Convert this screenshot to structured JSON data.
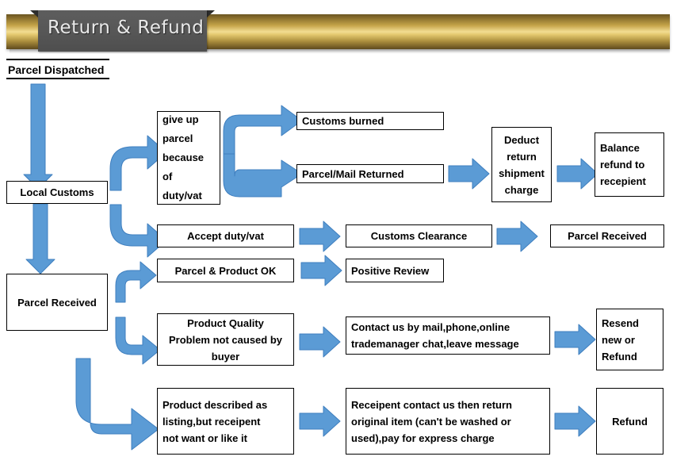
{
  "header": {
    "title": "Return & Refund",
    "bar_color_top": "#6b5522",
    "bar_color_mid": "#f2dd92",
    "ribbon_color": "#585858",
    "title_color": "#e9e9e9"
  },
  "theme": {
    "arrow_fill": "#5b9bd5",
    "arrow_stroke": "#3f7fbf",
    "box_border": "#000000",
    "box_fill": "#ffffff",
    "text_color": "#000000"
  },
  "flowchart": {
    "type": "flowchart",
    "orientation": "left-to-right",
    "nodes": [
      {
        "id": "parcel_dispatched",
        "label": "Parcel Dispatched",
        "style": "banner"
      },
      {
        "id": "local_customs",
        "label": "Local Customs",
        "style": "box-center"
      },
      {
        "id": "parcel_received_l",
        "label": "Parcel Received",
        "style": "box-center"
      },
      {
        "id": "give_up_parcel",
        "label": "give up parcel because of duty/vat",
        "style": "box-left"
      },
      {
        "id": "customs_burned",
        "label": "Customs burned",
        "style": "box-left"
      },
      {
        "id": "parcel_mail_returned",
        "label": "Parcel/Mail Returned",
        "style": "box-left"
      },
      {
        "id": "deduct_charge",
        "label": "Deduct return shipment charge",
        "style": "box-center"
      },
      {
        "id": "balance_refund",
        "label": "Balance refund to recepient",
        "style": "box-left"
      },
      {
        "id": "accept_duty",
        "label": "Accept duty/vat",
        "style": "box-center"
      },
      {
        "id": "customs_clearance",
        "label": "Customs Clearance",
        "style": "box-center"
      },
      {
        "id": "parcel_received_r",
        "label": "Parcel Received",
        "style": "box-center"
      },
      {
        "id": "parcel_product_ok",
        "label": "Parcel & Product OK",
        "style": "box-center"
      },
      {
        "id": "positive_review",
        "label": "Positive Review",
        "style": "box-left"
      },
      {
        "id": "quality_problem",
        "label": "Product Quality Problem not caused by buyer",
        "style": "box-center"
      },
      {
        "id": "contact_us",
        "label": "Contact us by mail,phone,online trademanager chat,leave message",
        "style": "box-left"
      },
      {
        "id": "resend_refund",
        "label": "Resend new or Refund",
        "style": "box-left"
      },
      {
        "id": "described_as_listing",
        "label": "Product described as listing,but receipent not want or like it",
        "style": "box-left"
      },
      {
        "id": "return_original",
        "label": "Receipent contact us then return original item (can't be washed or used),pay for express charge",
        "style": "box-left"
      },
      {
        "id": "refund",
        "label": "Refund",
        "style": "box-center"
      }
    ],
    "edges": [
      {
        "from": "parcel_dispatched",
        "to": "local_customs",
        "shape": "straight-down"
      },
      {
        "from": "local_customs",
        "to": "give_up_parcel",
        "shape": "elbow-up-right"
      },
      {
        "from": "local_customs",
        "to": "accept_duty",
        "shape": "elbow-down-right"
      },
      {
        "from": "local_customs",
        "to": "parcel_received_l",
        "shape": "straight-down"
      },
      {
        "from": "give_up_parcel",
        "to": "customs_burned",
        "shape": "fork-up"
      },
      {
        "from": "give_up_parcel",
        "to": "parcel_mail_returned",
        "shape": "fork-down"
      },
      {
        "from": "parcel_mail_returned",
        "to": "deduct_charge",
        "shape": "straight-right"
      },
      {
        "from": "deduct_charge",
        "to": "balance_refund",
        "shape": "straight-right"
      },
      {
        "from": "accept_duty",
        "to": "customs_clearance",
        "shape": "straight-right"
      },
      {
        "from": "customs_clearance",
        "to": "parcel_received_r",
        "shape": "straight-right"
      },
      {
        "from": "parcel_received_l",
        "to": "parcel_product_ok",
        "shape": "elbow-up-right"
      },
      {
        "from": "parcel_received_l",
        "to": "quality_problem",
        "shape": "elbow-down-right"
      },
      {
        "from": "parcel_received_l",
        "to": "described_as_listing",
        "shape": "elbow-down-right-long"
      },
      {
        "from": "parcel_product_ok",
        "to": "positive_review",
        "shape": "straight-right"
      },
      {
        "from": "quality_problem",
        "to": "contact_us",
        "shape": "straight-right"
      },
      {
        "from": "contact_us",
        "to": "resend_refund",
        "shape": "straight-right"
      },
      {
        "from": "described_as_listing",
        "to": "return_original",
        "shape": "straight-right"
      },
      {
        "from": "return_original",
        "to": "refund",
        "shape": "straight-right"
      }
    ]
  },
  "labels": {
    "parcel_dispatched": "Parcel Dispatched",
    "local_customs": "Local Customs",
    "parcel_received_left": "Parcel Received",
    "give_up_parcel_l1": "give up",
    "give_up_parcel_l2": "parcel",
    "give_up_parcel_l3": "because",
    "give_up_parcel_l4": "of",
    "give_up_parcel_l5": "duty/vat",
    "customs_burned": "Customs burned",
    "parcel_mail_returned": "Parcel/Mail Returned",
    "deduct_l1": "Deduct",
    "deduct_l2": "return",
    "deduct_l3": "shipment",
    "deduct_l4": "charge",
    "balance_l1": "Balance",
    "balance_l2": "refund to",
    "balance_l3": "recepient",
    "accept_duty": "Accept duty/vat",
    "customs_clearance": "Customs Clearance",
    "parcel_received_right": "Parcel Received",
    "parcel_product_ok": "Parcel & Product OK",
    "positive_review": "Positive Review",
    "quality_l1": "Product Quality",
    "quality_l2": "Problem not caused by",
    "quality_l3": "buyer",
    "contact_l1": "Contact us by mail,phone,online",
    "contact_l2": "trademanager chat,leave message",
    "resend_l1": "Resend",
    "resend_l2": "new or",
    "resend_l3": "Refund",
    "listing_l1": "Product described as",
    "listing_l2": "listing,but receipent",
    "listing_l3": "not want or like it",
    "return_l1": "Receipent contact us then return",
    "return_l2": "original item (can't be washed or",
    "return_l3": "used),pay for express charge",
    "refund": "Refund"
  }
}
